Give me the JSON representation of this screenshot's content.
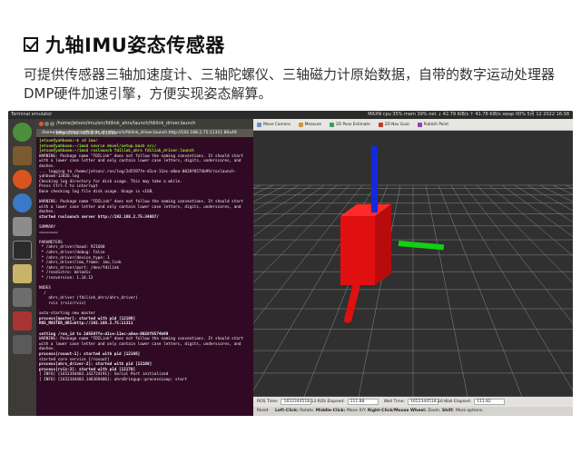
{
  "header": {
    "title": "九轴IMU姿态传感器",
    "description": "可提供传感器三轴加速度计、三轴陀螺仪、三轴磁力计原始数据，自带的数字运动处理器DMP硬件加速引擎，方便实现姿态解算。"
  },
  "system_bar": {
    "app_title": "Terminal emulator",
    "indicators": "MAXN   cpu 35% mem 39% net ↓ 42.79 KiB/s ↑ 41.78 KiB/s swap 00%      5月 12 2022  16:38 "
  },
  "terminal": {
    "window_title": "/home/jetson/imu/src/fdilink_ahrs/launch/fdilink_driver.launch http://192.168.2.75:11311",
    "tab_title": "/home/jetson/imu/src/fdilink_ahrs/launch/fdilink_driver.launch http://192.168.2.75:11311 80x49",
    "lines": [
      {
        "text": "jetson@yahboom:~$ cd imu/",
        "style": "prompt"
      },
      {
        "text": "jetson@yahboom:~/imu$ source devel/setup.bash src/",
        "style": "prompt"
      },
      {
        "text": "jetson@yahboom:~/imu$ roslaunch fdilink_ahrs fdilink_driver.launch",
        "style": "prompt"
      },
      {
        "text": "WARNING: Package name \"FDILink\" does not follow the naming conventions. It should start with a lower case letter and only contain lower case letters, digits, underscores, and dashes.",
        "style": ""
      },
      {
        "text": "... logging to /home/jetson/.ros/log/2d5597fe-d1ce-11ec-a8ea-0028f8574b99/roslaunch-yahboom-12026.log",
        "style": ""
      },
      {
        "text": "Checking log directory for disk usage. This may take a while.",
        "style": ""
      },
      {
        "text": "Press Ctrl-C to interrupt",
        "style": ""
      },
      {
        "text": "Done checking log file disk usage. Usage is <1GB.",
        "style": ""
      },
      {
        "text": " ",
        "style": ""
      },
      {
        "text": "WARNING: Package name \"FDILink\" does not follow the naming conventions. It should start with a lower case letter and only contain lower case letters, digits, underscores, and dashes.",
        "style": ""
      },
      {
        "text": "started roslaunch server http://192.168.2.75:34867/",
        "style": "bold"
      },
      {
        "text": " ",
        "style": ""
      },
      {
        "text": "SUMMARY",
        "style": ""
      },
      {
        "text": "========",
        "style": ""
      },
      {
        "text": " ",
        "style": ""
      },
      {
        "text": "PARAMETERS",
        "style": ""
      },
      {
        "text": " * /ahrs_driver/baud: 921600",
        "style": ""
      },
      {
        "text": " * /ahrs_driver/debug: False",
        "style": ""
      },
      {
        "text": " * /ahrs_driver/device_type: 1",
        "style": ""
      },
      {
        "text": " * /ahrs_driver/imu_frame: imu_link",
        "style": ""
      },
      {
        "text": " * /ahrs_driver/port: /dev/fdilink",
        "style": ""
      },
      {
        "text": " * /rosdistro: melodic",
        "style": ""
      },
      {
        "text": " * /rosversion: 1.14.12",
        "style": ""
      },
      {
        "text": " ",
        "style": ""
      },
      {
        "text": "NODES",
        "style": ""
      },
      {
        "text": "  /",
        "style": ""
      },
      {
        "text": "    ahrs_driver (fdilink_ahrs/ahrs_driver)",
        "style": ""
      },
      {
        "text": "    rviz (rviz/rviz)",
        "style": ""
      },
      {
        "text": " ",
        "style": ""
      },
      {
        "text": "auto-starting new master",
        "style": ""
      },
      {
        "text": "process[master]: started with pid [12100]",
        "style": "bold"
      },
      {
        "text": "ROS_MASTER_URI=http://192.168.2.75:11311",
        "style": "bold"
      },
      {
        "text": " ",
        "style": ""
      },
      {
        "text": "setting /run_id to 2d5597fe-d1ce-11ec-a8ea-0028f8574b99",
        "style": "bold"
      },
      {
        "text": "WARNING: Package name \"FDILink\" does not follow the naming conventions. It should start with a lower case letter and only contain lower case letters, digits, underscores, and dashes.",
        "style": ""
      },
      {
        "text": "process[rosout-1]: started with pid [12166]",
        "style": "bold"
      },
      {
        "text": "started core service [/rosout]",
        "style": ""
      },
      {
        "text": "process[ahrs_driver-2]: started with pid [12169]",
        "style": "bold"
      },
      {
        "text": "process[rviz-3]: started with pid [12170]",
        "style": "bold"
      },
      {
        "text": "[ INFO] [1652344403.142724191]: Serial Port initialized",
        "style": ""
      },
      {
        "text": "[ INFO] [1652344403.146369406]: ahrsBringup::processLoop: start",
        "style": ""
      }
    ]
  },
  "rviz": {
    "tools": [
      "Move Camera",
      "Measure",
      "2D Pose Estimate",
      "2D Nav Goal",
      "Publish Point"
    ],
    "ros_time_label": "ROS Time:",
    "ros_time_value": "1652344518.13",
    "ros_elapsed_label": "ROS Elapsed:",
    "ros_elapsed_value": "111.88",
    "wall_time_label": "Wall Time:",
    "wall_time_value": "1652344518.16",
    "wall_elapsed_label": "Wall Elapsed:",
    "wall_elapsed_value": "111.82",
    "reset_label": "Reset",
    "hint": {
      "k1": "Left-Click:",
      "v1": " Rotate. ",
      "k2": "Middle-Click:",
      "v2": " Move X/Y. ",
      "k3": "Right-Click/Mouse Wheel:",
      "v3": " Zoom. ",
      "k4": "Shift",
      "v4": ": More options."
    }
  },
  "colors": {
    "cube": "#e01010",
    "axis_x": "#e01010",
    "axis_y": "#12d012",
    "axis_z": "#1428e0",
    "grid": "#8a8a8a"
  }
}
